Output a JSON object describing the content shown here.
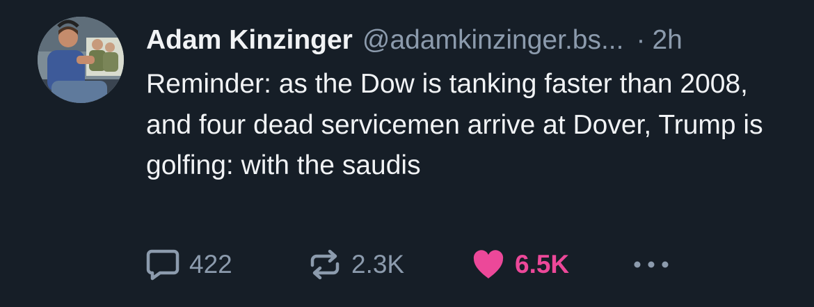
{
  "post": {
    "author_name": "Adam Kinzinger",
    "author_handle": "@adamkinzinger.bs...",
    "separator": "·",
    "timestamp": "2h",
    "text": "Reminder: as the Dow is tanking faster than 2008, and four dead servicemen arrive at Dover, Trump is golfing: with the saudis"
  },
  "actions": {
    "reply_count": "422",
    "repost_count": "2.3K",
    "like_count": "6.5K",
    "liked": true
  },
  "icons": {
    "reply": "speech-bubble-icon",
    "repost": "repost-arrows-icon",
    "like": "heart-icon",
    "more": "ellipsis-icon"
  },
  "colors": {
    "background": "#161e27",
    "text": "#f1f3f5",
    "muted": "#8c9bad",
    "like_active": "#ec4899"
  }
}
